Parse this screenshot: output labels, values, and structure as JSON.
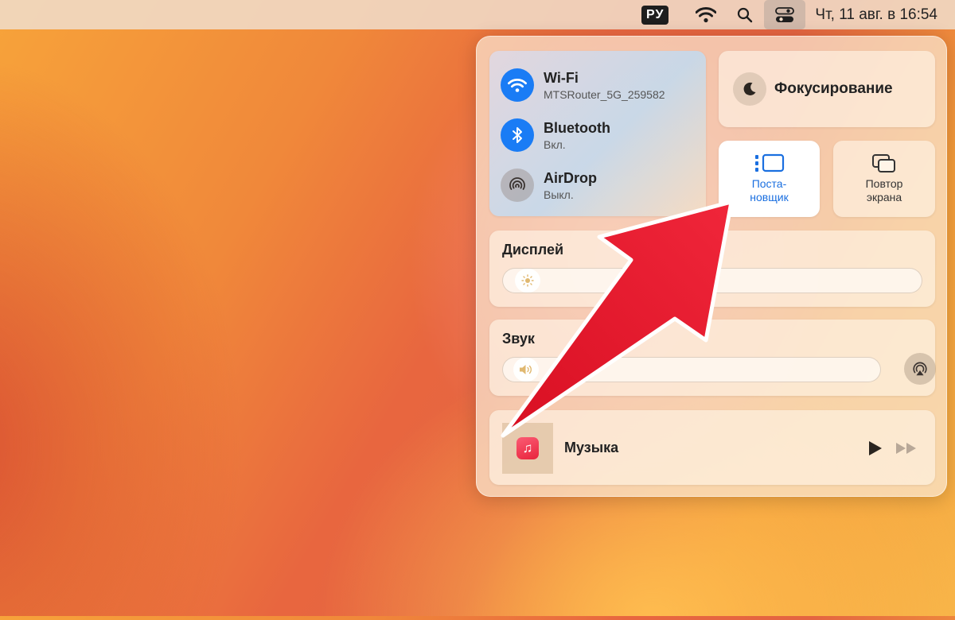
{
  "menubar": {
    "lang": "РУ",
    "clock": "Чт, 11 авг. в 16:54",
    "icons": [
      "wifi-icon",
      "search-icon",
      "control-center-icon"
    ]
  },
  "control_center": {
    "wifi": {
      "title": "Wi-Fi",
      "subtitle": "MTSRouter_5G_259582",
      "icon": "wifi-icon"
    },
    "bluetooth": {
      "title": "Bluetooth",
      "subtitle": "Вкл.",
      "icon": "bluetooth-icon"
    },
    "airdrop": {
      "title": "AirDrop",
      "subtitle": "Выкл.",
      "icon": "airdrop-icon"
    },
    "focus": {
      "label": "Фокусирование",
      "icon": "moon-icon"
    },
    "stage_manager": {
      "line1": "Поста-",
      "line2": "новщик",
      "icon": "stage-manager-icon"
    },
    "screen_mirroring": {
      "line1": "Повтор",
      "line2": "экрана",
      "icon": "screen-mirroring-icon"
    },
    "display": {
      "label": "Дисплей",
      "brightness": 0.03
    },
    "sound": {
      "label": "Звук",
      "volume": 0.03
    },
    "music": {
      "label": "Музыка"
    }
  },
  "colors": {
    "accent_blue": "#1a7cf5",
    "annotation_red": "#e8192d"
  }
}
